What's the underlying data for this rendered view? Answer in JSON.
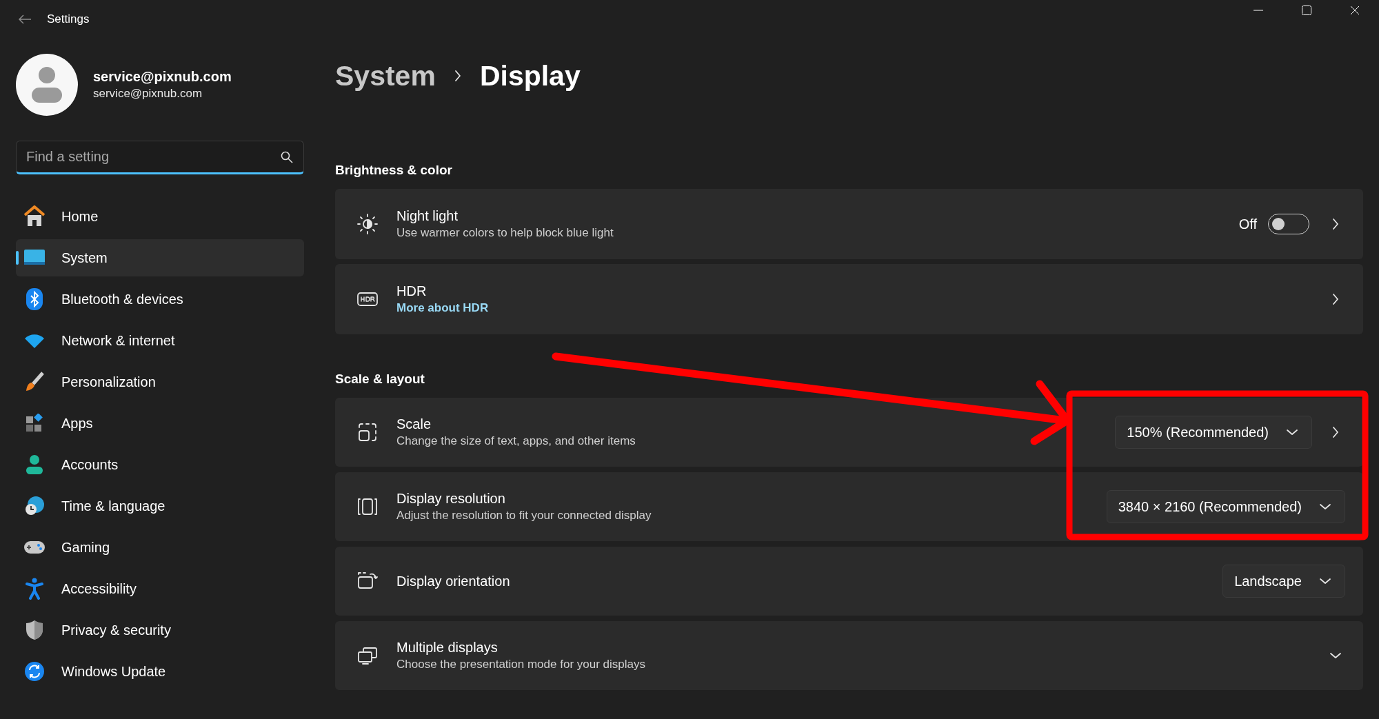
{
  "window": {
    "title": "Settings"
  },
  "account": {
    "name": "service@pixnub.com",
    "email": "service@pixnub.com"
  },
  "search": {
    "placeholder": "Find a setting"
  },
  "nav": [
    {
      "label": "Home",
      "selected": false
    },
    {
      "label": "System",
      "selected": true
    },
    {
      "label": "Bluetooth & devices",
      "selected": false
    },
    {
      "label": "Network & internet",
      "selected": false
    },
    {
      "label": "Personalization",
      "selected": false
    },
    {
      "label": "Apps",
      "selected": false
    },
    {
      "label": "Accounts",
      "selected": false
    },
    {
      "label": "Time & language",
      "selected": false
    },
    {
      "label": "Gaming",
      "selected": false
    },
    {
      "label": "Accessibility",
      "selected": false
    },
    {
      "label": "Privacy & security",
      "selected": false
    },
    {
      "label": "Windows Update",
      "selected": false
    }
  ],
  "breadcrumb": {
    "parent": "System",
    "current": "Display"
  },
  "sections": [
    {
      "title": "Brightness & color",
      "rows": [
        {
          "kind": "toggle",
          "title": "Night light",
          "subtitle": "Use warmer colors to help block blue light",
          "state_label": "Off",
          "on": false
        },
        {
          "kind": "link",
          "title": "HDR",
          "link": "More about HDR"
        }
      ]
    },
    {
      "title": "Scale & layout",
      "rows": [
        {
          "kind": "dropdown-nav",
          "title": "Scale",
          "subtitle": "Change the size of text, apps, and other items",
          "value": "150% (Recommended)"
        },
        {
          "kind": "dropdown",
          "title": "Display resolution",
          "subtitle": "Adjust the resolution to fit your connected display",
          "value": "3840 × 2160 (Recommended)"
        },
        {
          "kind": "dropdown",
          "title": "Display orientation",
          "value": "Landscape"
        },
        {
          "kind": "expand",
          "title": "Multiple displays",
          "subtitle": "Choose the presentation mode for your displays",
          "expanded": false
        }
      ]
    }
  ],
  "annotation": {
    "arrow": true,
    "highlight_box": true
  }
}
